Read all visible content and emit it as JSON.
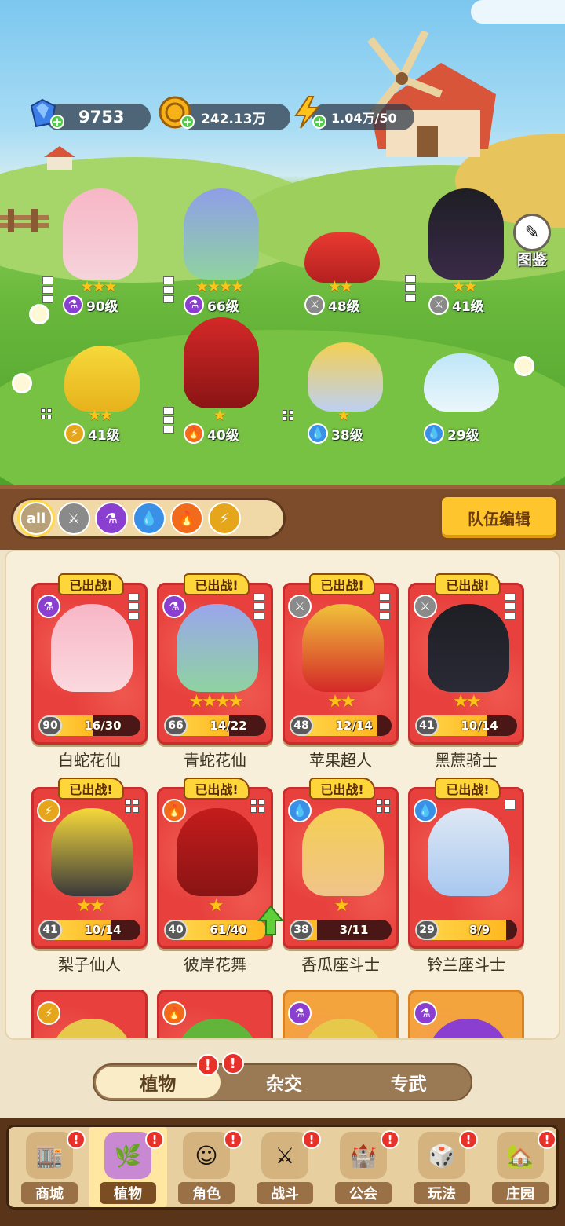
{
  "resources": {
    "gems": "9753",
    "gold": "242.13万",
    "energy": "1.04万/50"
  },
  "codex_label": "图鉴",
  "field_heroes": [
    {
      "stars": "★★★",
      "level": "90级",
      "element": "potion"
    },
    {
      "stars": "★★★★",
      "level": "66级",
      "element": "potion"
    },
    {
      "stars": "★★",
      "level": "48级",
      "element": "sword"
    },
    {
      "stars": "★★",
      "level": "41级",
      "element": "sword"
    },
    {
      "stars": "★★",
      "level": "41级",
      "element": "lightning"
    },
    {
      "stars": "★",
      "level": "40级",
      "element": "fire"
    },
    {
      "stars": "★",
      "level": "38级",
      "element": "water"
    },
    {
      "stars": "",
      "level": "29级",
      "element": "water"
    }
  ],
  "filters": {
    "all_label": "all",
    "items": [
      "all",
      "sword",
      "potion",
      "water",
      "fire",
      "lightning"
    ]
  },
  "team_edit_label": "队伍编辑",
  "deployed_label": "已出战!",
  "roster": [
    {
      "name": "白蛇花仙",
      "level": "90",
      "progress": "16/30",
      "fill": 0.53,
      "stars": "",
      "element": "potion"
    },
    {
      "name": "青蛇花仙",
      "level": "66",
      "progress": "14/22",
      "fill": 0.64,
      "stars": "★★★★",
      "element": "potion"
    },
    {
      "name": "苹果超人",
      "level": "48",
      "progress": "12/14",
      "fill": 0.86,
      "stars": "★★",
      "element": "sword"
    },
    {
      "name": "黑蔗骑士",
      "level": "41",
      "progress": "10/14",
      "fill": 0.71,
      "stars": "★★",
      "element": "sword"
    },
    {
      "name": "梨子仙人",
      "level": "41",
      "progress": "10/14",
      "fill": 0.71,
      "stars": "★★",
      "element": "lightning"
    },
    {
      "name": "彼岸花舞",
      "level": "40",
      "progress": "61/40",
      "fill": 1.0,
      "stars": "★",
      "element": "fire"
    },
    {
      "name": "香瓜座斗士",
      "level": "38",
      "progress": "3/11",
      "fill": 0.27,
      "stars": "★",
      "element": "water"
    },
    {
      "name": "铃兰座斗士",
      "level": "29",
      "progress": "8/9",
      "fill": 0.89,
      "stars": "",
      "element": "water"
    }
  ],
  "partial_cards": [
    {
      "element": "lightning"
    },
    {
      "element": "fire"
    },
    {
      "element": "potion"
    },
    {
      "element": "potion"
    }
  ],
  "subtabs": [
    "植物",
    "杂交",
    "专武"
  ],
  "nav": [
    "商城",
    "植物",
    "角色",
    "战斗",
    "公会",
    "玩法",
    "庄园"
  ],
  "alert_mark": "!",
  "colors": {
    "card_red": "#e8413d",
    "progress_fill": "#ffc52c",
    "accent_yellow": "#ffc52c"
  }
}
